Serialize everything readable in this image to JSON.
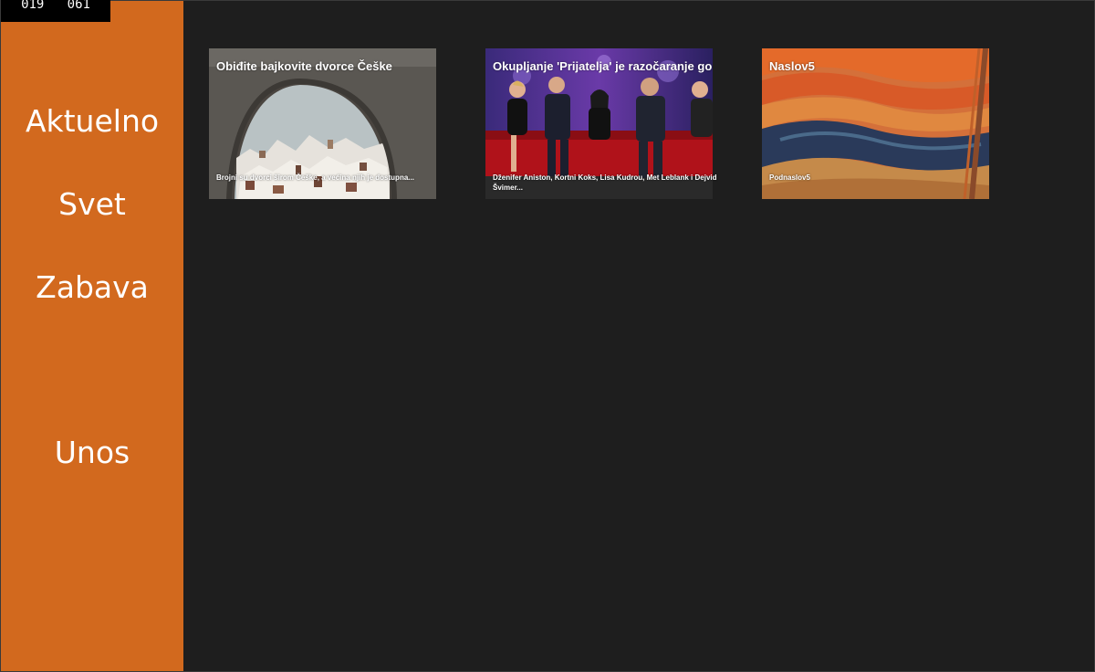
{
  "debug": {
    "counter": "019   061"
  },
  "nav": {
    "items": [
      {
        "label": "Aktuelno"
      },
      {
        "label": "Svet"
      },
      {
        "label": "Zabava"
      },
      {
        "label": "Unos"
      }
    ]
  },
  "tiles": [
    {
      "title": "Obiđite bajkovite dvorce Češke",
      "subtitle": "Brojni su dvorci širom Češke, a većina njih je dostupna...",
      "image": "snowy-castle-town-through-stone-arch"
    },
    {
      "title": "Okupljanje 'Prijatelja' je razočaranje go",
      "subtitle": "Dženifer Aniston, Kortni Koks, Lisa Kudrou, Met Leblank i Dejvid Švimer...",
      "image": "friends-reunion-on-red-couch"
    },
    {
      "title": "Naslov5",
      "subtitle": "Podnaslov5",
      "image": "the-scream-painting"
    }
  ],
  "colors": {
    "sidebar": "#d2691e",
    "background": "#1e1e1e",
    "text": "#ffffff"
  }
}
